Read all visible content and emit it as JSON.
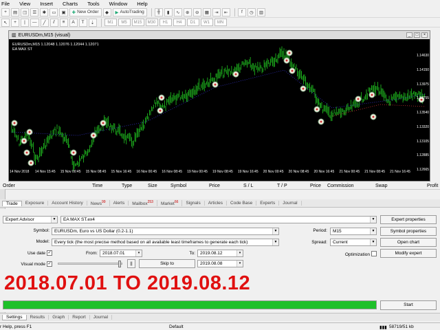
{
  "menu": [
    "File",
    "View",
    "Insert",
    "Charts",
    "Tools",
    "Window",
    "Help"
  ],
  "toolbar": {
    "new_order": "New Order",
    "autotrading": "AutoTrading",
    "timeframes": [
      "M1",
      "M5",
      "M15",
      "M30",
      "H1",
      "H4",
      "D1",
      "W1",
      "MN"
    ]
  },
  "chart": {
    "window_title": "EURUSDm,M15 (visual)",
    "info_line1": "EURUSDm,M15  1.12048 1.12076 1.12044 1.12071",
    "info_line2": "EA MAX ST",
    "price_labels": [
      "1.14630",
      "1.14150",
      "1.13975",
      "1.13755",
      "1.13540",
      "1.13320",
      "1.13105",
      "1.12885",
      "1.12665"
    ],
    "time_labels": [
      "14 Nov 2018",
      "14 Nov 15:45",
      "15 Nov 00:45",
      "15 Nov 08:45",
      "15 Nov 16:45",
      "16 Nov 00:45",
      "16 Nov 08:45",
      "19 Nov 00:45",
      "19 Nov 08:45",
      "19 Nov 16:45",
      "20 Nov 00:45",
      "20 Nov 08:45",
      "20 Nov 16:45",
      "21 Nov 00:45",
      "21 Nov 08:45",
      "21 Nov 16:45"
    ],
    "colors": {
      "background": "#000000",
      "candles": "#22cc22",
      "ma_red": "#c83232",
      "ma_blue": "#3232c8"
    }
  },
  "terminal_columns": [
    "Order",
    "Time",
    "Type",
    "Size",
    "Symbol",
    "Price",
    "S / L",
    "T / P",
    "Price",
    "Commission",
    "Swap",
    "Profit"
  ],
  "terminal_tabs": [
    {
      "label": "Trade",
      "badge": ""
    },
    {
      "label": "Exposure",
      "badge": ""
    },
    {
      "label": "Account History",
      "badge": ""
    },
    {
      "label": "News",
      "badge": "99"
    },
    {
      "label": "Alerts",
      "badge": ""
    },
    {
      "label": "Mailbox",
      "badge": "253"
    },
    {
      "label": "Market",
      "badge": "66"
    },
    {
      "label": "Signals",
      "badge": ""
    },
    {
      "label": "Articles",
      "badge": ""
    },
    {
      "label": "Code Base",
      "badge": ""
    },
    {
      "label": "Experts",
      "badge": ""
    },
    {
      "label": "Journal",
      "badge": ""
    }
  ],
  "tester": {
    "mode": "Expert Advisor",
    "expert": "EA MAX ST.ex4",
    "symbol_label": "Symbol:",
    "symbol": "EURUSDm, Euro vs US Dollar (0.2-1.1)",
    "model_label": "Model:",
    "model": "Every tick (the most precise method based on all available least timeframes to generate each tick)",
    "use_date_label": "Use date",
    "from_label": "From:",
    "from": "2018.07.01",
    "to_label": "To:",
    "to": "2019.08.12",
    "visual_mode_label": "Visual mode",
    "skip_to_label": "Skip to",
    "skip_to_date": "2019.08.08",
    "pause_label": "||",
    "period_label": "Period:",
    "period": "M15",
    "spread_label": "Spread:",
    "spread": "Current",
    "optimization_label": "Optimization",
    "buttons": {
      "expert_properties": "Expert properties",
      "symbol_properties": "Symbol properties",
      "open_chart": "Open chart",
      "modify_expert": "Modify expert",
      "start": "Start"
    },
    "progress": 1.0
  },
  "overlay_text": "2018.07.01 TO 2019.08.12",
  "tester_tabs": [
    "Settings",
    "Results",
    "Graph",
    "Report",
    "Journal"
  ],
  "status": {
    "help": "r Help, press F1",
    "profile": "Default",
    "traffic": "58719/51 kb"
  }
}
